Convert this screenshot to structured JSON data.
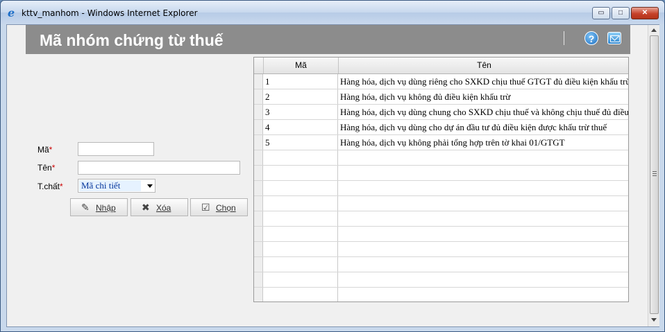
{
  "window": {
    "title": "kttv_manhom - Windows Internet Explorer",
    "buttons": {
      "minimize": "▭",
      "maximize": "□",
      "close": "✕"
    }
  },
  "header": {
    "title": "Mã nhóm chứng từ thuế",
    "help_icon": "help-icon",
    "mail_icon": "mail-icon",
    "help_glyph": "?"
  },
  "form": {
    "ma_label": "Mã",
    "ten_label": "Tên",
    "tchat_label": "T.chất",
    "required_mark": "*",
    "ma_value": "",
    "ten_value": "",
    "tchat_value": "Mã chi tiết"
  },
  "buttons": {
    "nhap": {
      "label": "Nhập",
      "icon": "edit-icon",
      "glyph": "✎"
    },
    "xoa": {
      "label": "Xóa",
      "icon": "delete-icon",
      "glyph": "✖"
    },
    "chon": {
      "label": "Chọn",
      "icon": "select-icon",
      "glyph": "☑"
    }
  },
  "grid": {
    "columns": [
      "Mã",
      "Tên"
    ],
    "rows": [
      {
        "ma": "1",
        "ten": "Hàng hóa, dịch vụ dùng riêng cho SXKD chịu thuế GTGT đủ điều kiện khấu trừ thuế"
      },
      {
        "ma": "2",
        "ten": "Hàng hóa, dịch vụ không đủ điều kiện khấu trừ"
      },
      {
        "ma": "3",
        "ten": "Hàng hóa, dịch vụ dùng chung cho SXKD chịu thuế và không chịu thuế đủ điều kiện khấu trừ"
      },
      {
        "ma": "4",
        "ten": "Hàng hóa, dịch vụ dùng cho dự án đầu tư đủ điều kiện được khấu trừ thuế"
      },
      {
        "ma": "5",
        "ten": "Hàng hóa, dịch vụ không phải tổng hợp trên tờ khai 01/GTGT"
      },
      {
        "ma": "",
        "ten": ""
      },
      {
        "ma": "",
        "ten": ""
      },
      {
        "ma": "",
        "ten": ""
      },
      {
        "ma": "",
        "ten": ""
      },
      {
        "ma": "",
        "ten": ""
      },
      {
        "ma": "",
        "ten": ""
      },
      {
        "ma": "",
        "ten": ""
      },
      {
        "ma": "",
        "ten": ""
      },
      {
        "ma": "",
        "ten": ""
      },
      {
        "ma": "",
        "ten": ""
      }
    ]
  }
}
